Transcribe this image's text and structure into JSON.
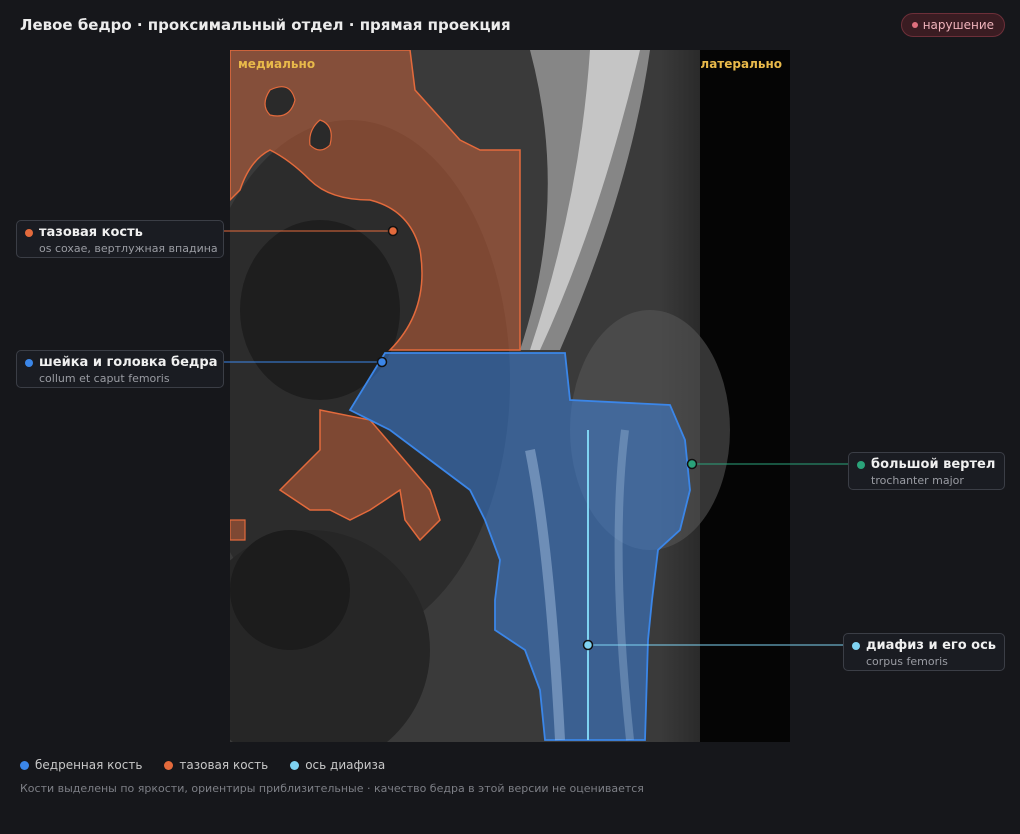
{
  "header": {
    "title": "Левое бедро · проксимальный отдел · прямая проекция",
    "badge_label": "нарушение"
  },
  "viewer": {
    "orient_medial": "медиально",
    "orient_lateral": "латерально"
  },
  "callouts": [
    {
      "name": "тазовая кость",
      "sub": "os coxae, вертлужная впадина",
      "color": "#e36a3c"
    },
    {
      "name": "шейка и головка бедра",
      "sub": "collum et caput femoris",
      "color": "#3b86e8"
    },
    {
      "name": "большой вертел",
      "sub": "trochanter major",
      "color": "#2aa37a"
    },
    {
      "name": "диафиз и его ось",
      "sub": "corpus femoris",
      "color": "#7fd3f2"
    }
  ],
  "legend": [
    {
      "label": "бедренная кость",
      "color": "#3b86e8"
    },
    {
      "label": "тазовая кость",
      "color": "#e36a3c"
    },
    {
      "label": "ось диафиза",
      "color": "#7fd3f2"
    }
  ],
  "footnote": "Кости выделены по яркости, ориентиры приблизительные · качество бедра в этой версии не оценивается"
}
